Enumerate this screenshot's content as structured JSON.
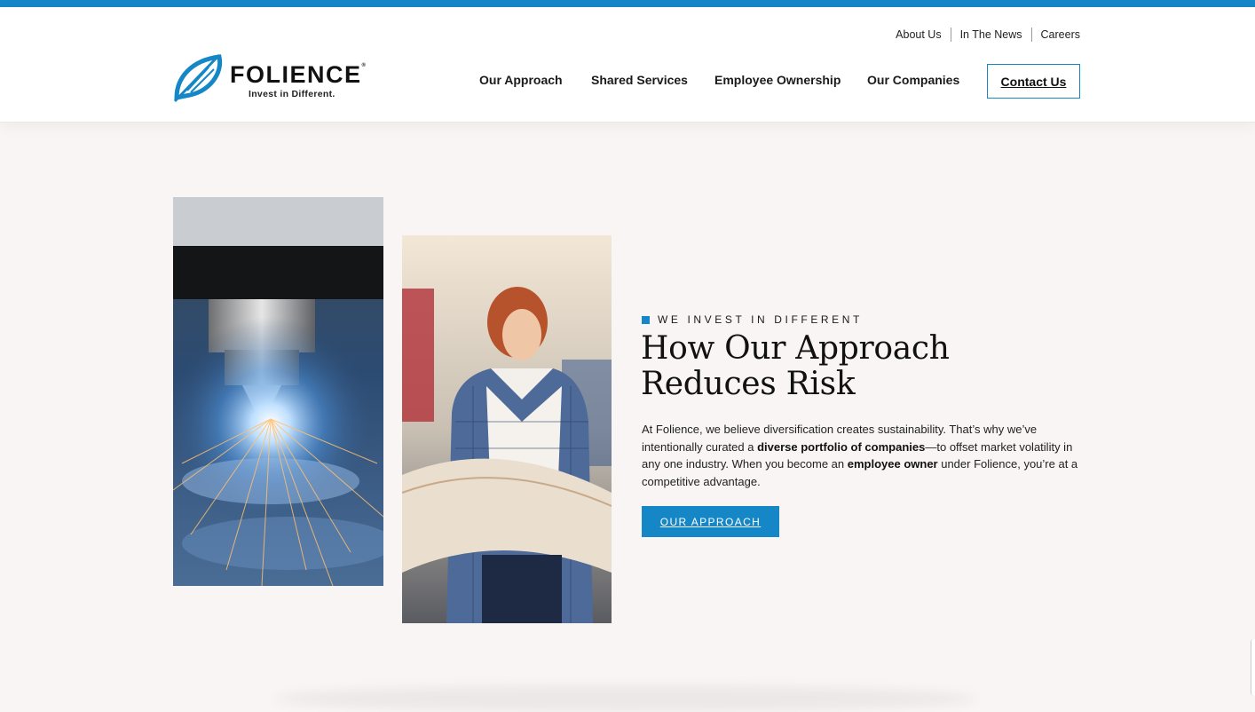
{
  "brand": {
    "name": "FOLIENCE",
    "registered": "®",
    "tagline": "Invest in Different.",
    "accent_color": "#1587c6",
    "logo_icon": "leaf-logo-icon"
  },
  "utility_nav": [
    "About Us",
    "In The News",
    "Careers"
  ],
  "main_nav": [
    "Our Approach",
    "Shared Services",
    "Employee Ownership",
    "Our Companies"
  ],
  "contact_button": "Contact Us",
  "hero": {
    "eyebrow": "WE INVEST IN DIFFERENT",
    "heading": "How Our Approach Reduces Risk",
    "body": {
      "p1": "At Folience, we believe diversification creates sustainability.  That’s why we’ve intentionally curated a ",
      "b1": "diverse portfolio of companies",
      "p2": "—to offset market volatility in any one industry. When you become an ",
      "b2": "employee owner",
      "p3": " under Folience, you’re at a competitive advantage."
    },
    "cta": "OUR APPROACH",
    "images": [
      "laser-cutter-sparks-photo",
      "woman-reviewing-blueprint-photo"
    ]
  }
}
